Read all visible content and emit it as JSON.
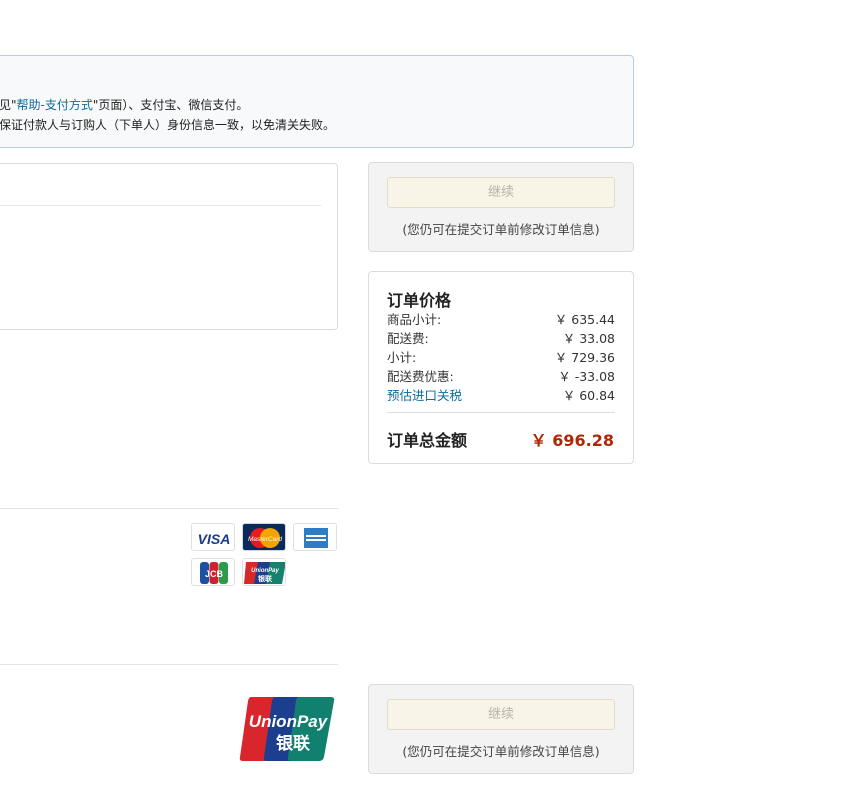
{
  "info": {
    "line1_prefix": "见\"",
    "line1_link": "帮助-支付方式",
    "line1_suffix": "\"页面）、支付宝、微信支付。",
    "line2": "保证付款人与订购人（下单人）身份信息一致，以免清关失败。"
  },
  "continue_top": {
    "button_label": "继续",
    "note": "(您仍可在提交订单前修改订单信息)"
  },
  "continue_bottom": {
    "button_label": "继续",
    "note": "(您仍可在提交订单前修改订单信息)"
  },
  "order_price": {
    "title": "订单价格",
    "rows": [
      {
        "label": "商品小计:",
        "value": "￥ 635.44"
      },
      {
        "label": "配送费:",
        "value": "￥ 33.08"
      },
      {
        "label": "小计:",
        "value": "￥ 729.36"
      },
      {
        "label": "配送费优惠:",
        "value": "￥ -33.08"
      },
      {
        "label": "预估进口关税",
        "value": "￥ 60.84"
      }
    ],
    "total_label": "订单总金额",
    "total_value": "￥ 696.28"
  },
  "cards": {
    "visa_text": "VISA",
    "mastercard_text": "MasterCard",
    "unionpay_text": "UnionPay",
    "unionpay_cn": "银联",
    "jcb_text": "JCB"
  },
  "colors": {
    "link": "#0a6c9e",
    "total": "#b12704",
    "button_bg": "#f8f4e7"
  }
}
